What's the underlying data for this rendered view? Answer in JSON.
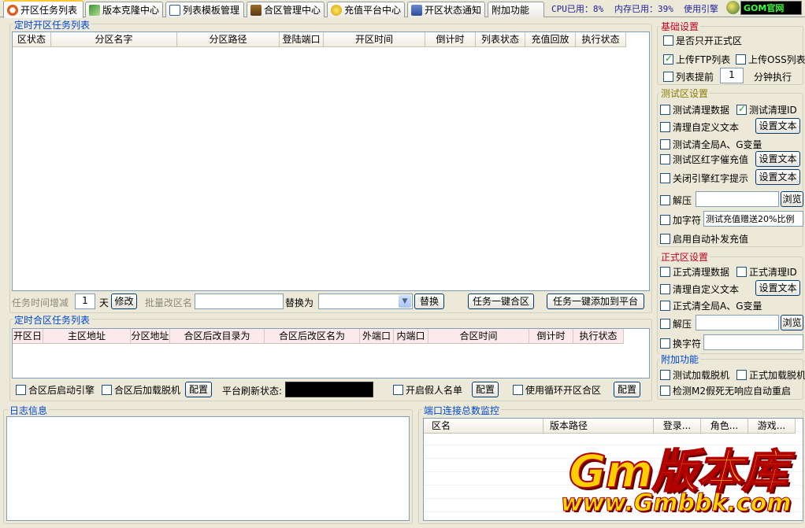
{
  "tabs": [
    {
      "label": "开区任务列表",
      "icon": "calendar-icon",
      "active": true
    },
    {
      "label": "版本克隆中心",
      "icon": "clone-icon"
    },
    {
      "label": "列表模板管理",
      "icon": "list-template-icon"
    },
    {
      "label": "合区管理中心",
      "icon": "merge-icon"
    },
    {
      "label": "充值平台中心",
      "icon": "coin-icon"
    },
    {
      "label": "开区状态通知",
      "icon": "notify-icon"
    },
    {
      "label": "附加功能",
      "icon": ""
    }
  ],
  "status": {
    "cpu": "CPU已用：8%",
    "mem": "内存已用：39%",
    "engine": "使用引擎",
    "site": "GOM官网"
  },
  "open_tasks": {
    "title": "定时开区任务列表",
    "columns": [
      "区状态",
      "分区名字",
      "分区路径",
      "登陆端口",
      "开区时间",
      "倒计时",
      "列表状态",
      "充值回放",
      "执行状态"
    ]
  },
  "task_bar": {
    "time_adjust_label": "任务时间增减",
    "days_value": "1",
    "days_unit": "天",
    "modify_button": "修改",
    "batch_rename_label": "批量改区名",
    "batch_rename_value": "",
    "replace_label": "替换为",
    "replace_value": "",
    "replace_button": "替换",
    "merge_all_button": "任务一键合区",
    "add_platform_button": "任务一键添加到平台"
  },
  "merge_tasks": {
    "title": "定时合区任务列表",
    "columns": [
      "开区日",
      "主区地址",
      "分区地址",
      "合区后改目录为",
      "合区后改区名为",
      "外端口",
      "内端口",
      "合区时间",
      "倒计时",
      "执行状态"
    ]
  },
  "merge_bar": {
    "start_engine": "合区后启动引擎",
    "load_offline": "合区后加载脱机",
    "config_button": "配置",
    "refresh_label": "平台刷新状态:",
    "refresh_value": "",
    "fake_list": "开启假人名单",
    "config_button2": "配置",
    "cycle_open": "使用循环开区合区",
    "config_button3": "配置"
  },
  "log": {
    "title": "日志信息"
  },
  "monitor": {
    "title": "端口连接总数监控",
    "columns": [
      "区名",
      "版本路径",
      "登录...",
      "角色...",
      "游戏..."
    ]
  },
  "basic": {
    "title": "基础设置",
    "only_official": "是否只开正式区",
    "upload_ftp": "上传FTP列表",
    "upload_oss": "上传OSS列表",
    "list_ahead": "列表提前",
    "ahead_value": "1",
    "ahead_unit": "分钟执行"
  },
  "test": {
    "title": "测试区设置",
    "clear_data": "测试清理数据",
    "clear_id": "测试清理ID",
    "clear_custom_text": "清理自定义文本",
    "set_text": "设置文本",
    "clear_global_ag": "测试清全局A、G变量",
    "red_prompt": "测试区红字催充值",
    "set_text2": "设置文本",
    "close_engine_red": "关闭引擎红字提示",
    "set_text3": "设置文本",
    "unzip": "解压",
    "unzip_value": "",
    "browse": "浏览",
    "add_char": "加字符",
    "add_char_value": "测试充值赠送20%比例",
    "auto_recharge": "启用自动补发充值"
  },
  "official": {
    "title": "正式区设置",
    "clear_data": "正式清理数据",
    "clear_id": "正式清理ID",
    "clear_custom_text": "清理自定义文本",
    "set_text": "设置文本",
    "clear_global_ag": "正式清全局A、G变量",
    "unzip": "解压",
    "unzip_value": "",
    "browse": "浏览",
    "swap_char": "换字符",
    "swap_char_value": ""
  },
  "extra": {
    "title": "附加功能",
    "test_load_offline": "测试加载脱机",
    "official_load_offline": "正式加载脱机",
    "detect_m2": "检测M2假死无响应自动重启"
  },
  "watermark": {
    "logo": "Gm版本库",
    "url": "www.Gmbbk.com"
  }
}
